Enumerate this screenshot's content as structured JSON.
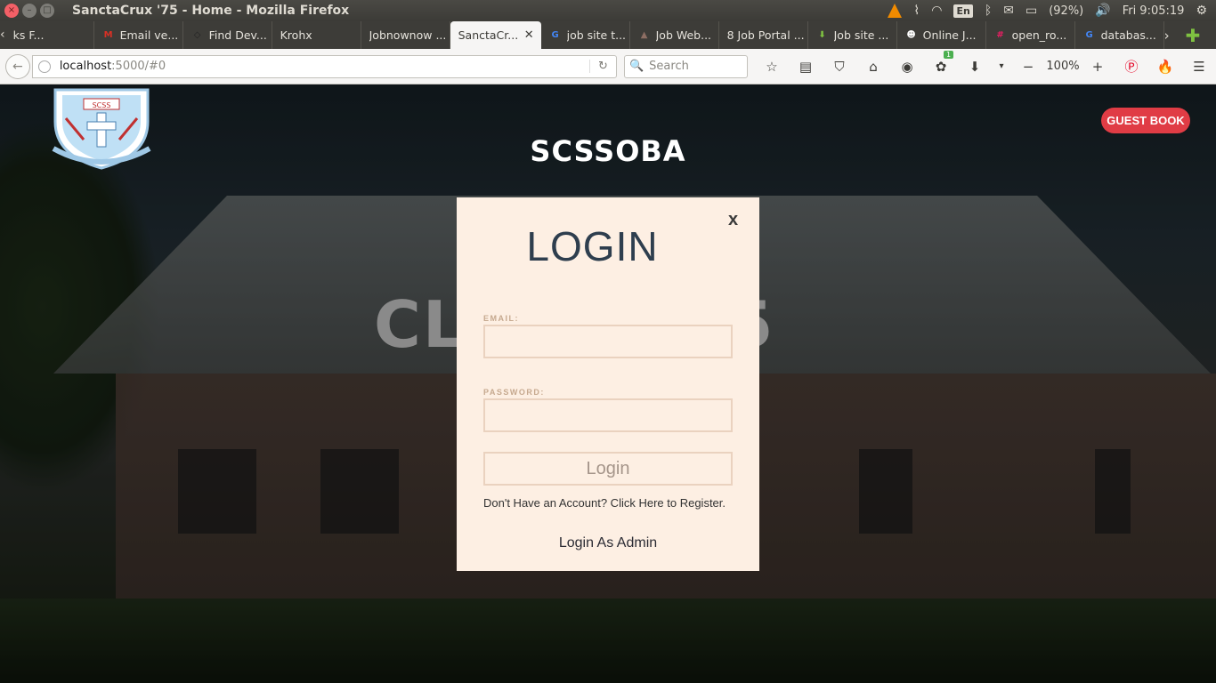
{
  "system": {
    "window_title": "SanctaCrux '75 - Home - Mozilla Firefox",
    "keyboard_lang": "En",
    "battery": "(92%)",
    "clock": "Fri  9:05:19"
  },
  "tabs": [
    {
      "label": "ks F...",
      "icon": "generic-icon",
      "color": "#888888"
    },
    {
      "label": "Email ve...",
      "icon": "gmail-icon",
      "color": "#d93025"
    },
    {
      "label": "Find Dev...",
      "icon": "code-icon",
      "color": "#222222"
    },
    {
      "label": "Krohx",
      "icon": "blank-icon",
      "color": "#3d3c38"
    },
    {
      "label": "Jobnownow ...",
      "icon": "blank-icon",
      "color": "#3d3c38"
    },
    {
      "label": "SanctaCr...",
      "icon": "blank-icon",
      "color": "#f6f5f4",
      "active": true
    },
    {
      "label": "job site t...",
      "icon": "google-icon",
      "color": "#4285f4"
    },
    {
      "label": "Job Web...",
      "icon": "hat-icon",
      "color": "#8d6e63"
    },
    {
      "label": "8 Job Portal ...",
      "icon": "blank-icon",
      "color": "#3d3c38"
    },
    {
      "label": "Job site ...",
      "icon": "download-icon",
      "color": "#7fc241"
    },
    {
      "label": "Online J...",
      "icon": "face-icon",
      "color": "#ffffff"
    },
    {
      "label": "open_ro...",
      "icon": "hash-icon",
      "color": "#e91e63"
    },
    {
      "label": "databas...",
      "icon": "google-icon",
      "color": "#4285f4"
    }
  ],
  "nav": {
    "url_host": "localhost",
    "url_path": ":5000/#0",
    "search_placeholder": "Search",
    "zoom": "100%",
    "notification_count": "1"
  },
  "page": {
    "site_title": "SCSSOBA",
    "guest_book_label": "GUEST BOOK",
    "hero_text": "CL         75",
    "logo_text": "SCSS"
  },
  "login_modal": {
    "close_label": "x",
    "title": "LOGIN",
    "email_label": "EMAIL:",
    "password_label": "PASSWORD:",
    "login_button": "Login",
    "register_text": "Don't Have an Account? Click Here to Register.",
    "admin_link": "Login As Admin"
  },
  "colors": {
    "modal_bg": "#fdefe3",
    "guest_book_bg": "#e03c45",
    "title_color": "#2e3e4e"
  }
}
